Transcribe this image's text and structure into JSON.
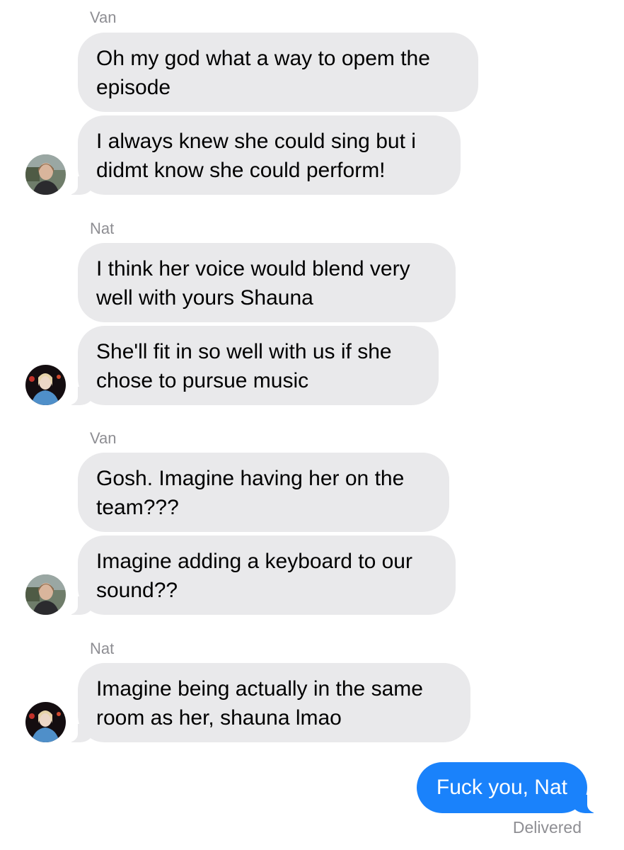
{
  "thread": {
    "groups": [
      {
        "sender": "Van",
        "messages": [
          "Oh my god what a way to opem the\nepisode",
          "I always knew she could sing but i\ndidmt know she could perform!"
        ]
      },
      {
        "sender": "Nat",
        "messages": [
          "I think her voice would blend very\nwell with yours Shauna",
          "She'll fit in so well with us if she\nchose to pursue music"
        ]
      },
      {
        "sender": "Van",
        "messages": [
          "Gosh. Imagine having her on the\nteam???",
          "Imagine adding a keyboard to our\nsound??"
        ]
      },
      {
        "sender": "Nat",
        "messages": [
          "Imagine being actually in the same\nroom as her, shauna lmao"
        ]
      }
    ],
    "outgoing": {
      "message": "Fuck you, Nat",
      "status": "Delivered"
    }
  },
  "colors": {
    "incoming_bubble": "#e9e9eb",
    "outgoing_bubble": "#1a82fb",
    "meta_text": "#8e8e93"
  },
  "icons": {
    "van_avatar": "van-avatar-icon",
    "nat_avatar": "nat-avatar-icon"
  }
}
